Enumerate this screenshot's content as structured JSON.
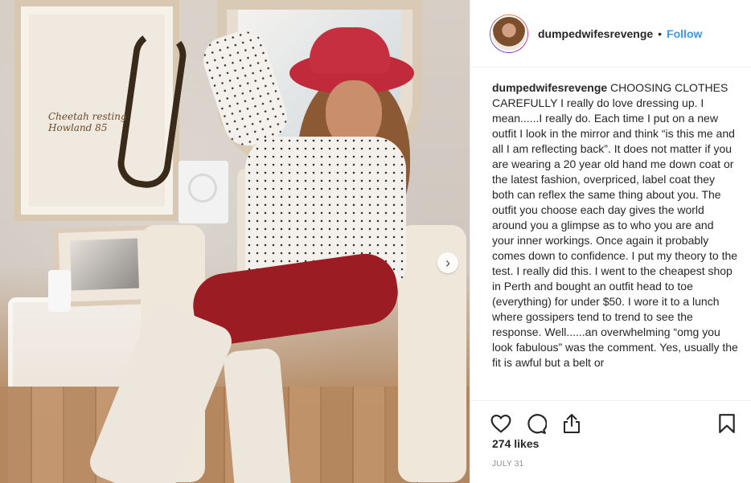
{
  "post": {
    "username": "dumpedwifesrevenge",
    "separator": "•",
    "follow_label": "Follow",
    "caption_username": "dumpedwifesrevenge",
    "caption_text": " CHOOSING CLOTHES CAREFULLY I really do love dressing up. I mean......I really do. Each time I put on a new outfit I look in the mirror and think “is this me and all I am reflecting back”. It does not matter if you are wearing a 20 year old hand me down coat or the latest fashion, overpriced, label coat they both can reflex the same thing about you. The outfit you choose each day gives the world around you a glimpse as to who you are and your inner workings. Once again it probably comes down to confidence. I put my theory to the test. I really did this. I went to the cheapest shop in Perth and bought an outfit head to toe (everything) for under $50. I wore it to a lunch where gossipers tend to trend to see the response. Well......an overwhelming “omg you look fabulous” was the comment. Yes, usually the fit is awful but a belt or",
    "likes": "274 likes",
    "date": "JULY 31"
  },
  "photo": {
    "poster_text": "Cheetah resting\nHowland 85"
  },
  "icons": {
    "like": "heart-icon",
    "comment": "comment-icon",
    "share": "share-icon",
    "save": "bookmark-icon",
    "next": "chevron-right-icon"
  },
  "colors": {
    "follow": "#3897f0",
    "text": "#262626",
    "muted": "#8e8e8e"
  }
}
